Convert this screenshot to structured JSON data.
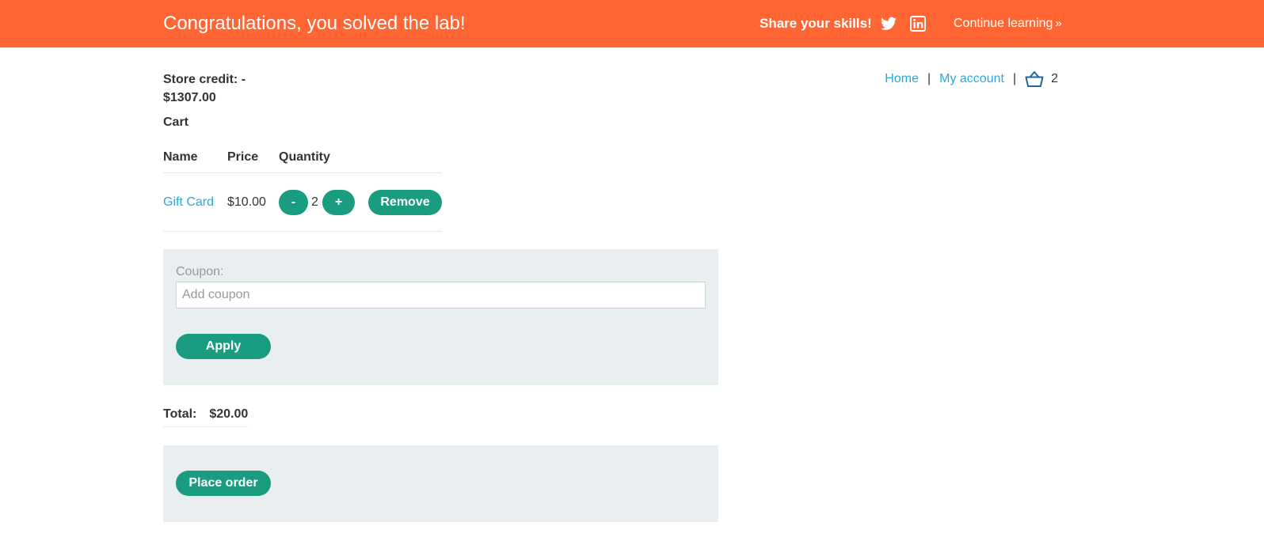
{
  "banner": {
    "title": "Congratulations, you solved the lab!",
    "share_label": "Share your skills!",
    "twitter_icon": "twitter-icon",
    "linkedin_icon": "linkedin-icon",
    "continue_label": "Continue learning",
    "continue_chevron": "»",
    "color": "#ff6633"
  },
  "account": {
    "store_credit": "Store credit: - $1307.00"
  },
  "nav": {
    "home": "Home",
    "separator": "|",
    "my_account": "My account",
    "basket_icon": "basket-icon",
    "cart_count": "2"
  },
  "cart": {
    "title": "Cart",
    "columns": [
      "Name",
      "Price",
      "Quantity"
    ],
    "items": [
      {
        "name": "Gift Card",
        "price": "$10.00",
        "quantity": "2",
        "decrement_label": "-",
        "increment_label": "+",
        "remove_label": "Remove"
      }
    ]
  },
  "coupon": {
    "label": "Coupon:",
    "placeholder": "Add coupon",
    "value": "",
    "apply_label": "Apply"
  },
  "total": {
    "label": "Total:",
    "value": "$20.00"
  },
  "order": {
    "place_order_label": "Place order"
  },
  "colors": {
    "accent_button": "#1a9c80",
    "link": "#29a8e0",
    "panel": "#e9eef0",
    "text": "#333332"
  }
}
